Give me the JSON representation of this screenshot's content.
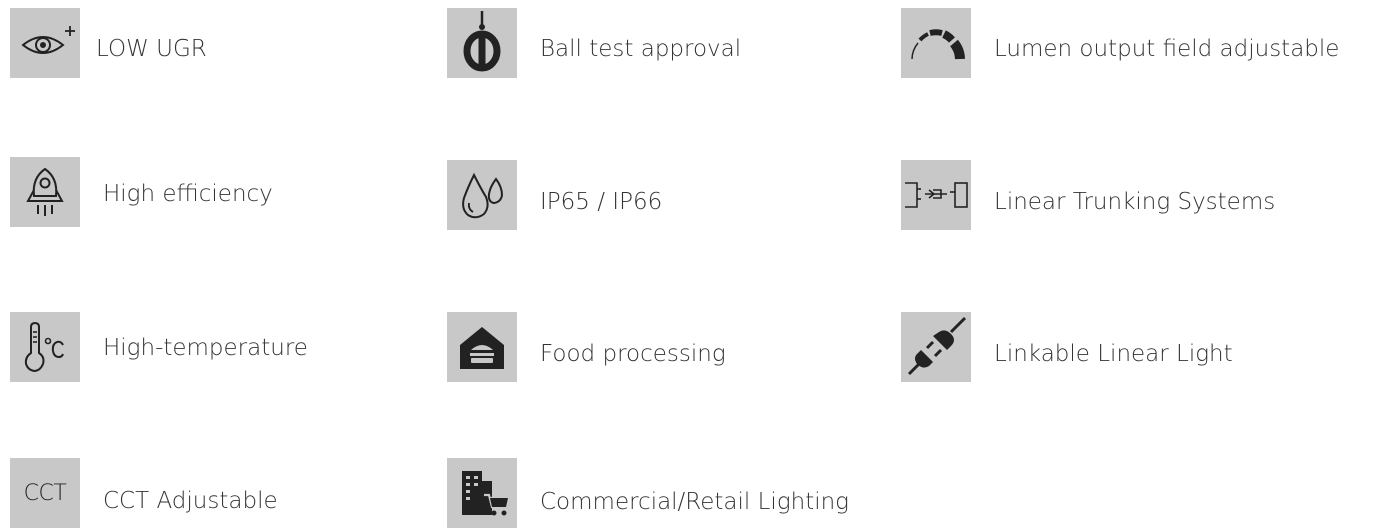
{
  "features": {
    "col1": [
      {
        "label": "LOW UGR",
        "icon": "eye-plus-icon"
      },
      {
        "label": "High efficiency",
        "icon": "rocket-icon"
      },
      {
        "label": "High-temperature",
        "icon": "thermometer-icon"
      },
      {
        "label": "CCT Adjustable",
        "icon": "cct-icon",
        "icon_text": "CCT"
      }
    ],
    "col2": [
      {
        "label": "Ball test approval",
        "icon": "ball-test-icon"
      },
      {
        "label": "IP65 / IP66",
        "icon": "water-drops-icon"
      },
      {
        "label": "Food processing",
        "icon": "food-house-icon"
      },
      {
        "label": "Commercial/Retail Lighting",
        "icon": "building-cart-icon"
      }
    ],
    "col3": [
      {
        "label": "Lumen output field adjustable",
        "icon": "gauge-icon"
      },
      {
        "label": "Linear Trunking Systems",
        "icon": "trunking-icon"
      },
      {
        "label": "Linkable Linear Light",
        "icon": "plug-icon"
      }
    ]
  },
  "colors": {
    "tile_background": "#c8c8c8",
    "icon_dark": "#222222",
    "text": "#333333"
  }
}
